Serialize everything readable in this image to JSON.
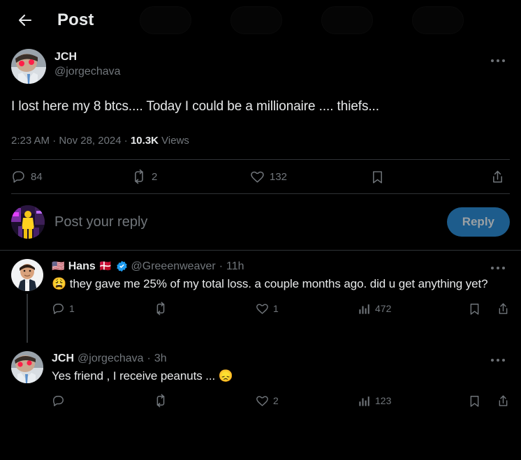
{
  "header": {
    "title": "Post",
    "back_icon": "arrow-left-icon"
  },
  "post": {
    "display_name": "JCH",
    "handle": "@jorgechava",
    "avatar": "jch-avatar",
    "text": "I lost here my 8 btcs.... Today I could be a millionaire .... thiefs...",
    "time": "2:23 AM",
    "separator1": " · ",
    "date": "Nov 28, 2024",
    "separator2": " · ",
    "views_count": "10.3K",
    "views_label": " Views",
    "more_icon": "more-horizontal-icon",
    "actions": {
      "reply_count": "84",
      "retweet_count": "2",
      "like_count": "132",
      "bookmark_count": "",
      "share_label": ""
    }
  },
  "composer": {
    "avatar": "user-avatar",
    "placeholder": "Post your reply",
    "button_label": "Reply",
    "button_color": "#1d5c8c"
  },
  "replies": [
    {
      "avatar": "hans-avatar",
      "flag_left": "🇺🇸",
      "display_name": "Hans",
      "flag_right": "🇩🇰",
      "verified": true,
      "handle": "@Greeenweaver",
      "time_sep": " · ",
      "timestamp": "11h",
      "emoji": "😩",
      "text": " they gave me 25% of my total loss.  a couple months ago. did u get anything yet?",
      "more_icon": "more-horizontal-icon",
      "actions": {
        "reply_count": "1",
        "retweet_count": "",
        "like_count": "1",
        "views_count": "472"
      }
    },
    {
      "avatar": "jch-avatar",
      "flag_left": "",
      "display_name": "JCH",
      "flag_right": "",
      "verified": false,
      "handle": "@jorgechava",
      "time_sep": " · ",
      "timestamp": "3h",
      "emoji": "😞",
      "text": "Yes friend , I receive peanuts ... ",
      "more_icon": "more-horizontal-icon",
      "actions": {
        "reply_count": "",
        "retweet_count": "",
        "like_count": "2",
        "views_count": "123"
      }
    }
  ],
  "colors": {
    "background": "#000000",
    "text_primary": "#e7e9ea",
    "text_secondary": "#71767b",
    "divider": "#2f3336",
    "verified_blue": "#1d9bf0",
    "reply_button": "#1d5c8c"
  }
}
